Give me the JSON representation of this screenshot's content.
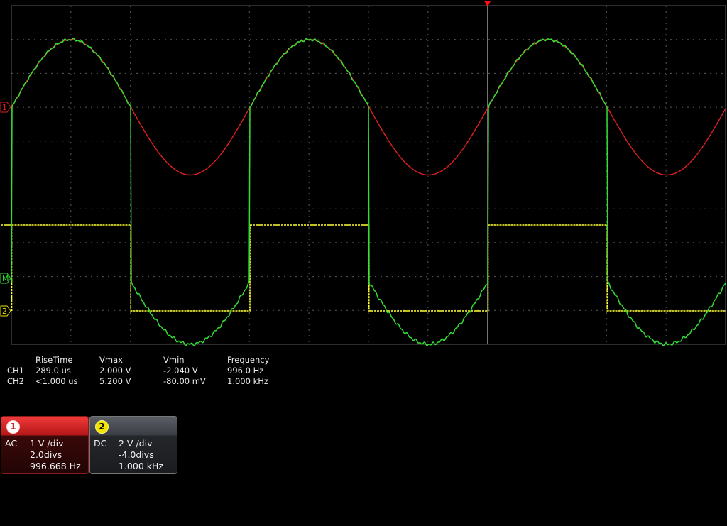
{
  "colors": {
    "ch1_trace": "#e02020",
    "ch2_trace": "#ffff33",
    "math_trace": "#33dd33",
    "grid": "#5a5a5a",
    "ch1_label": "#e02020",
    "ch2_label": "#e8e000",
    "math_label": "#33dd33",
    "trigger_marker": "#ff1010"
  },
  "screen": {
    "ch1_marker": "1",
    "ch2_marker": "2",
    "math_marker": "M",
    "ch1_frequency_hz": 996.668,
    "ch1_scale_v_per_div": 1,
    "ch1_offset_divs": 2.0,
    "ch2_scale_v_per_div": 2,
    "ch2_offset_divs": -4.0
  },
  "measurements": {
    "headers": [
      "RiseTime",
      "Vmax",
      "Vmin",
      "Frequency"
    ],
    "rows": [
      {
        "channel": "CH1",
        "values": [
          "289.0 us",
          "2.000 V",
          "-2.040 V",
          "996.0 Hz"
        ]
      },
      {
        "channel": "CH2",
        "values": [
          "<1.000 us",
          "5.200 V",
          "-80.00 mV",
          "1.000 kHz"
        ]
      }
    ]
  },
  "channels": [
    {
      "number": "1",
      "coupling": "AC",
      "scale": "1 V /div",
      "offset": "2.0divs",
      "frequency": "996.668 Hz"
    },
    {
      "number": "2",
      "coupling": "DC",
      "scale": "2 V /div",
      "offset": "-4.0divs",
      "frequency": "1.000 kHz"
    }
  ]
}
